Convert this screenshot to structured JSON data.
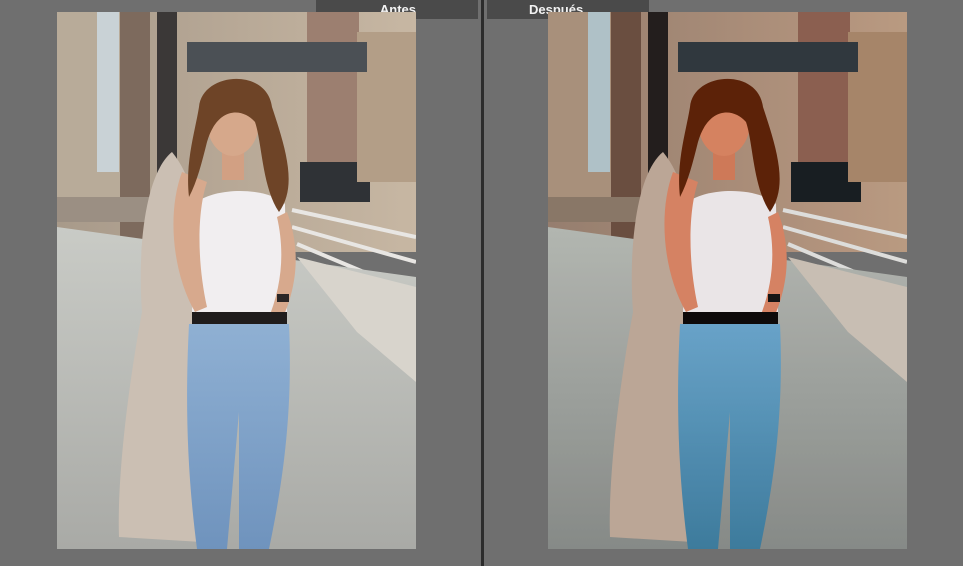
{
  "compare": {
    "before_label": "Antes",
    "after_label": "Después"
  },
  "colors": {
    "background": "#6f6f6f",
    "label_bar": "#4a4a4a",
    "divider": "#2c2c2c",
    "label_text": "#f2f2f2"
  }
}
